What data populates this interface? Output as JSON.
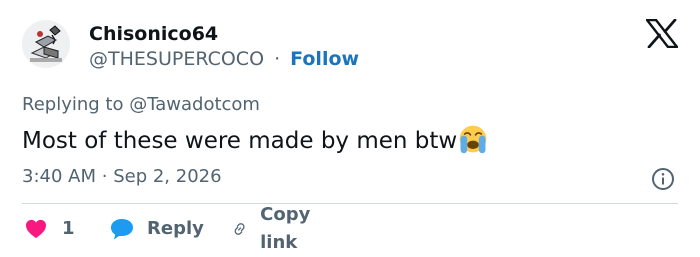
{
  "author": {
    "name": "Chisonico64",
    "handle": "@THESUPERCOCO",
    "separator": "·",
    "follow_label": "Follow"
  },
  "reply_context": {
    "prefix": "Replying to",
    "mention": "@Tawadotcom"
  },
  "tweet": {
    "text": "Most of these were made by men btw",
    "emoji": "loudly-crying-face"
  },
  "meta": {
    "time": "3:40 AM",
    "separator": "·",
    "date": "Sep 2, 2026"
  },
  "actions": {
    "like_count": "1",
    "reply_label": "Reply",
    "copy_label": "Copy link"
  },
  "colors": {
    "like": "#f91880",
    "reply_bubble": "#1d9bf0",
    "follow": "#1d74bd",
    "secondary_text": "#536471",
    "primary_text": "#0f1419",
    "divider": "#cfd9de"
  },
  "icons": [
    "x-logo-icon",
    "heart-icon",
    "reply-bubble-icon",
    "link-icon",
    "info-icon"
  ]
}
